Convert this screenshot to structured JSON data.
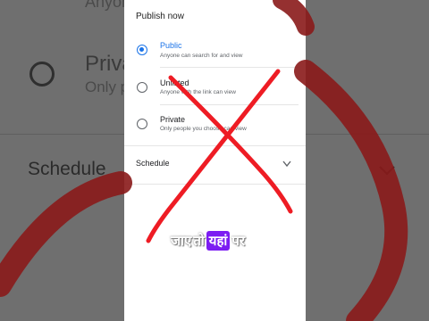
{
  "background": {
    "top_text": "Anyone",
    "private_label": "Priva",
    "only_label": "Only p",
    "schedule_label": "Schedule"
  },
  "sheet": {
    "title": "Publish now",
    "options": [
      {
        "label": "Public",
        "description": "Anyone can search for and view",
        "selected": true
      },
      {
        "label": "Unlisted",
        "description": "Anyone with the link can view",
        "selected": false
      },
      {
        "label": "Private",
        "description": "Only people you choose can view",
        "selected": false
      }
    ],
    "schedule_label": "Schedule"
  },
  "banner": {
    "word1": "जाए",
    "word2": "तो",
    "word3_highlight": "यहां",
    "word4": "पर"
  },
  "colors": {
    "accent": "#1a73e8",
    "cross": "#ee1c24",
    "highlight": "#7c1cf2"
  }
}
